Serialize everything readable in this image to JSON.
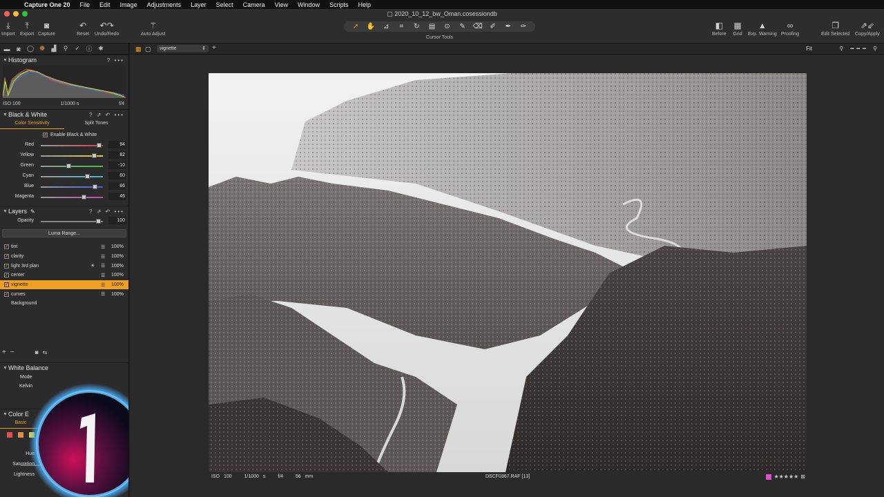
{
  "menubar": {
    "app": "Capture One 20",
    "items": [
      "File",
      "Edit",
      "Image",
      "Adjustments",
      "Layer",
      "Select",
      "Camera",
      "View",
      "Window",
      "Scripts",
      "Help"
    ]
  },
  "window": {
    "title": "2020_10_12_bw_Oman.cosessiondb"
  },
  "toolbar": {
    "import": "Import",
    "export": "Export",
    "capture": "Capture",
    "reset": "Reset",
    "undo_redo": "Undo/Redo",
    "auto_adjust": "Auto Adjust",
    "cursor_tools": "Cursor Tools",
    "before": "Before",
    "grid": "Grid",
    "exp_warning": "Exp. Warning",
    "proofing": "Proofing",
    "edit_selected": "Edit Selected",
    "copy_apply": "Copy/Apply"
  },
  "histogram": {
    "title": "Histogram",
    "iso": "ISO 100",
    "shutter": "1/1000 s",
    "aperture": "f/4"
  },
  "bw": {
    "title": "Black & White",
    "tab_color": "Color Sensitivity",
    "tab_split": "Split Tones",
    "enable_label": "Enable Black & White",
    "sliders": [
      {
        "label": "Red",
        "value": "94",
        "pos": 0.94,
        "color": "#e04040"
      },
      {
        "label": "Yellow",
        "value": "82",
        "pos": 0.87,
        "color": "#e0d040"
      },
      {
        "label": "Green",
        "value": "-10",
        "pos": 0.45,
        "color": "#40c040"
      },
      {
        "label": "Cyan",
        "value": "60",
        "pos": 0.76,
        "color": "#40c0d0"
      },
      {
        "label": "Blue",
        "value": "86",
        "pos": 0.88,
        "color": "#4060e0"
      },
      {
        "label": "Magenta",
        "value": "46",
        "pos": 0.7,
        "color": "#d040c0"
      }
    ]
  },
  "layers": {
    "title": "Layers",
    "opacity_label": "Opacity",
    "opacity_value": "100",
    "luma_range": "Luma Range...",
    "items": [
      {
        "name": "tint",
        "opacity": "100%"
      },
      {
        "name": "clarity",
        "opacity": "100%"
      },
      {
        "name": "light 3rd plan",
        "opacity": "100%"
      },
      {
        "name": "center",
        "opacity": "100%"
      },
      {
        "name": "vignette",
        "opacity": "100%"
      },
      {
        "name": "curves",
        "opacity": "100%"
      }
    ],
    "background": "Background"
  },
  "white_balance": {
    "title": "White Balance",
    "mode": "Mode",
    "kelvin": "Kelvin"
  },
  "color_editor": {
    "title": "Color E",
    "tab_basic": "Basic",
    "hue": "Hue",
    "saturation": "Saturation",
    "lightness": "Lightness",
    "hue_val": "0",
    "sat_val": "0"
  },
  "viewer": {
    "variant": "vignette",
    "fit": "Fit",
    "iso": "ISO 100",
    "shutter": "1/1000 s",
    "aperture": "f/4",
    "focal": "56 mm",
    "filename": "DSCF0367.RAF [13]",
    "rating": "★★★★★"
  },
  "colors": {
    "accent": "#f0a020",
    "panel": "#2b2b2b",
    "viewer_bg": "#2a2a2a",
    "color_tag": "#e04bd0"
  }
}
